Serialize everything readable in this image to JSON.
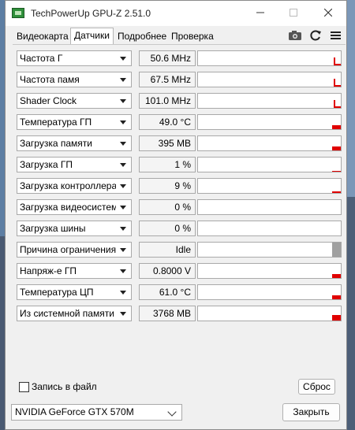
{
  "window": {
    "title": "TechPowerUp GPU-Z 2.51.0"
  },
  "tabs": [
    {
      "label": "Видеокарта",
      "active": false
    },
    {
      "label": "Датчики",
      "active": true
    },
    {
      "label": "Подробнее",
      "active": false
    },
    {
      "label": "Проверка",
      "active": false
    }
  ],
  "toolbar": {
    "icons": [
      "camera-icon",
      "refresh-icon",
      "menu-icon"
    ]
  },
  "sensors": [
    {
      "label": "Частота Г",
      "value": "50.6 MHz",
      "level": 0.55,
      "shape": "spike"
    },
    {
      "label": "Частота памя",
      "value": "67.5 MHz",
      "level": 0.55,
      "shape": "spike"
    },
    {
      "label": "Shader Clock",
      "value": "101.0 MHz",
      "level": 0.55,
      "shape": "spike"
    },
    {
      "label": "Температура ГП",
      "value": "49.0 °C",
      "level": 0.3,
      "shape": "bar"
    },
    {
      "label": "Загрузка памяти",
      "value": "395 MB",
      "level": 0.25,
      "shape": "bar"
    },
    {
      "label": "Загрузка ГП",
      "value": "1 %",
      "level": 0.05,
      "shape": "bar"
    },
    {
      "label": "Загрузка контроллера пам",
      "value": "9 %",
      "level": 0.1,
      "shape": "bar"
    },
    {
      "label": "Загрузка видеосистемы",
      "value": "0 %",
      "level": 0,
      "shape": "bar"
    },
    {
      "label": "Загрузка шины",
      "value": "0 %",
      "level": 0,
      "shape": "bar"
    },
    {
      "label": "Причина ограничения",
      "value": "Idle",
      "level": 1.0,
      "shape": "gray"
    },
    {
      "label": "Напряж-е ГП",
      "value": "0.8000 V",
      "level": 0.25,
      "shape": "bar"
    },
    {
      "label": "Температура ЦП",
      "value": "61.0 °C",
      "level": 0.3,
      "shape": "bar"
    },
    {
      "label": "Из системной памяти",
      "value": "3768 MB",
      "level": 0.4,
      "shape": "bar"
    }
  ],
  "log": {
    "label": "Запись в файл",
    "checked": false
  },
  "buttons": {
    "reset": "Сброс",
    "close": "Закрыть"
  },
  "gpu_select": {
    "value": "NVIDIA GeForce GTX 570M"
  },
  "colors": {
    "graph": "#e00000",
    "accent": "#2f8f3a"
  }
}
